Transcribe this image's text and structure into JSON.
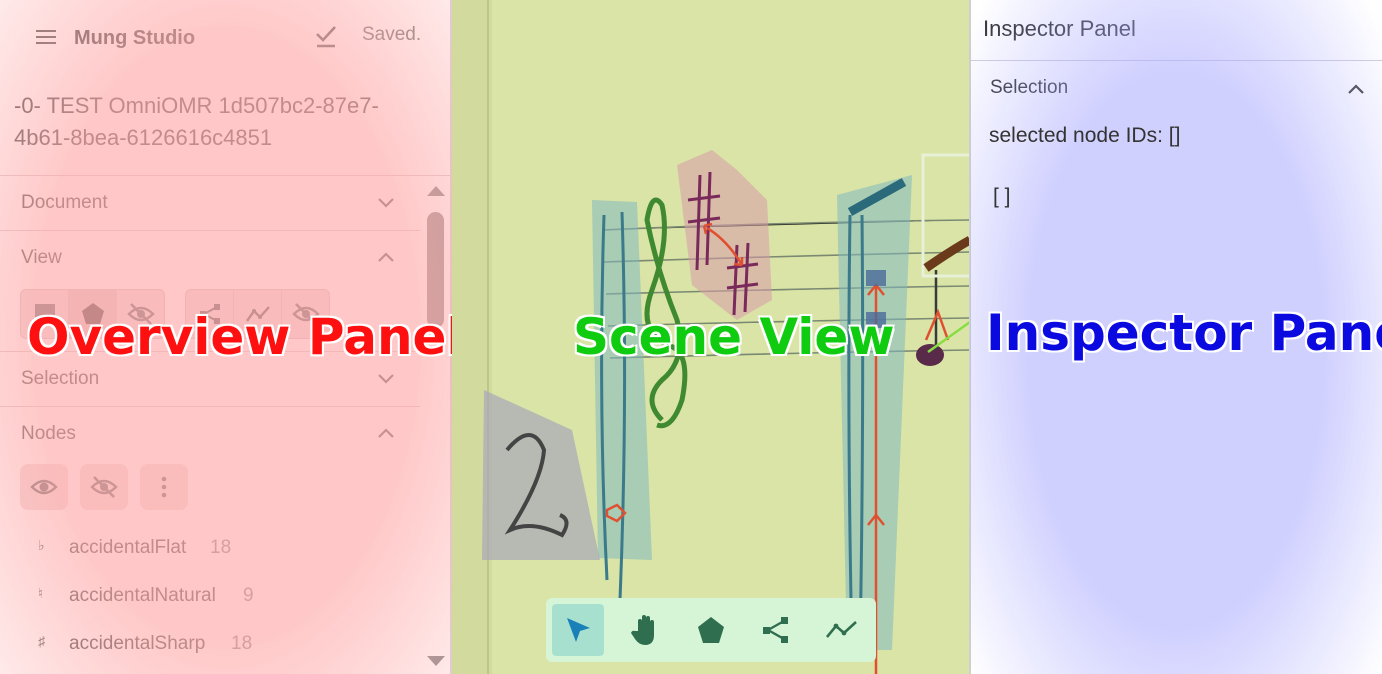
{
  "app": {
    "title": "Mung Studio",
    "save_status": "Saved."
  },
  "document_name": "-0- TEST OmniOMR 1d507bc2-87e7-4b61-8bea-6126616c4851",
  "overview": {
    "sections": {
      "document": "Document",
      "view": "View",
      "selection": "Selection",
      "nodes": "Nodes"
    },
    "node_classes": [
      {
        "glyph": "♭",
        "name": "accidentalFlat",
        "count": "18"
      },
      {
        "glyph": "♮",
        "name": "accidentalNatural",
        "count": "9"
      },
      {
        "glyph": "♯",
        "name": "accidentalSharp",
        "count": "18"
      }
    ]
  },
  "labels": {
    "overview": "Overview Panel",
    "scene": "Scene View",
    "inspector": "Inspector Panel"
  },
  "inspector": {
    "title": "Inspector Panel",
    "section": "Selection",
    "selected_ids_text": "selected node IDs: []",
    "json_value": "[ ]"
  },
  "toolbar": {
    "tools": [
      "pointer-icon",
      "hand-icon",
      "polygon-icon",
      "node-link-icon",
      "syntax-link-icon"
    ],
    "active": "pointer-icon"
  },
  "colors": {
    "overview_tint": "#ffb0b0",
    "inspector_tint": "#b0b0ff",
    "scene_bg": "#d8e3a8",
    "overview_label": "#ff1010",
    "scene_label": "#10cc10",
    "inspector_label": "#0a0ae0"
  }
}
